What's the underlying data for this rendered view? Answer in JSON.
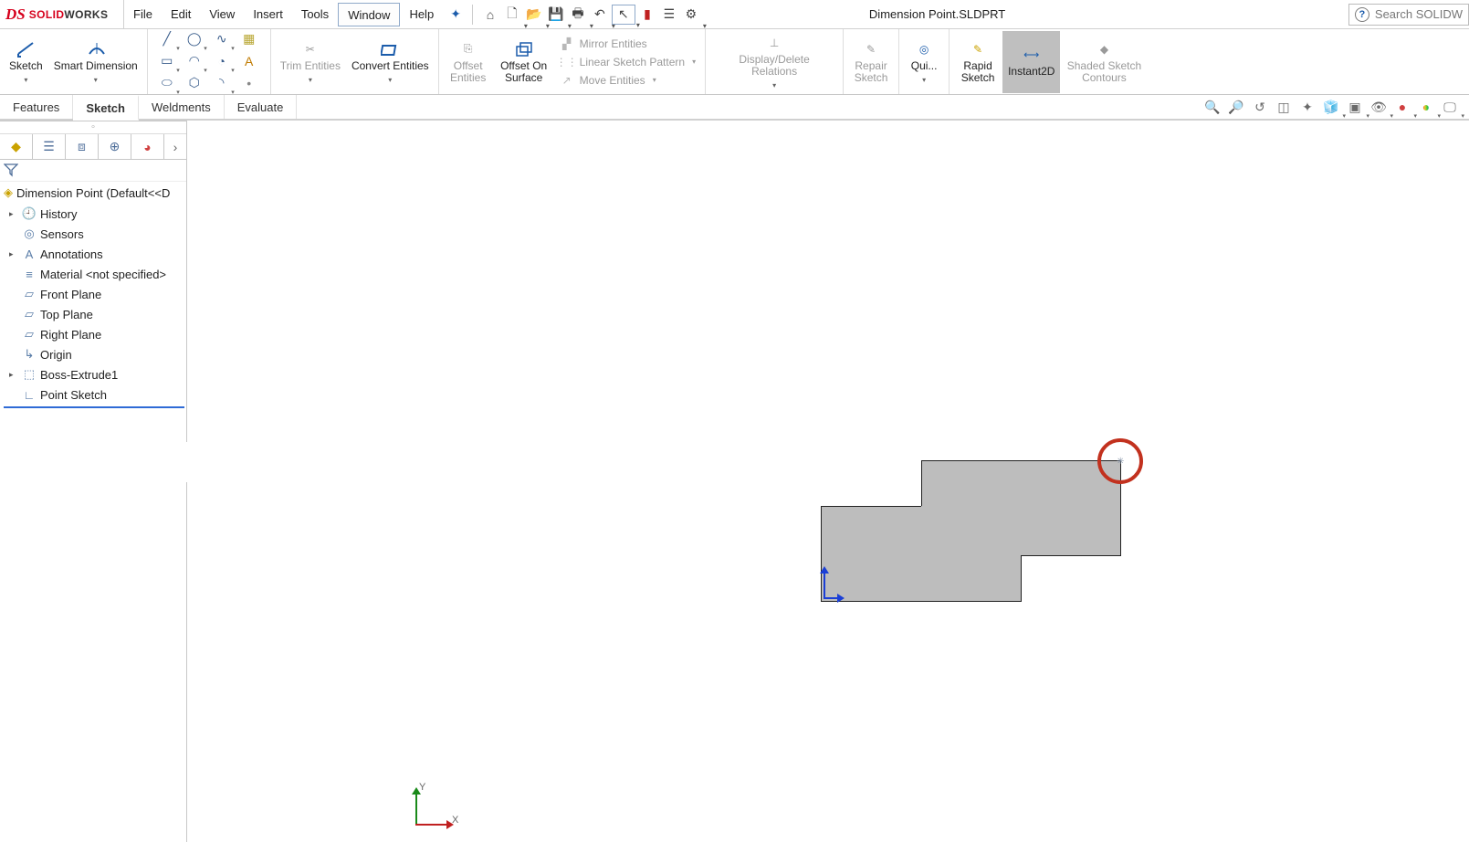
{
  "app": {
    "brand_prefix": "SOLID",
    "brand_suffix": "WORKS",
    "doc_title": "Dimension Point.SLDPRT",
    "search_placeholder": "Search SOLIDW"
  },
  "menubar": [
    "File",
    "Edit",
    "View",
    "Insert",
    "Tools",
    "Window",
    "Help"
  ],
  "ribbon": {
    "sketch_btn": "Sketch",
    "smart_dim": "Smart Dimension",
    "trim": "Trim Entities",
    "convert": "Convert Entities",
    "offset": "Offset Entities",
    "offset_surface": "Offset On Surface",
    "mirror": "Mirror Entities",
    "linear": "Linear Sketch Pattern",
    "move": "Move Entities",
    "display_rel": "Display/Delete Relations",
    "repair": "Repair Sketch",
    "quick": "Qui...",
    "rapid": "Rapid Sketch",
    "instant2d": "Instant2D",
    "shaded": "Shaded Sketch Contours"
  },
  "cmdtabs": [
    "Features",
    "Sketch",
    "Weldments",
    "Evaluate"
  ],
  "tree": {
    "root": "Dimension Point  (Default<<D",
    "nodes": [
      {
        "label": "History",
        "icon": "history"
      },
      {
        "label": "Sensors",
        "icon": "sensor"
      },
      {
        "label": "Annotations",
        "icon": "annot"
      },
      {
        "label": "Material <not specified>",
        "icon": "material"
      },
      {
        "label": "Front Plane",
        "icon": "plane"
      },
      {
        "label": "Top Plane",
        "icon": "plane"
      },
      {
        "label": "Right Plane",
        "icon": "plane"
      },
      {
        "label": "Origin",
        "icon": "origin"
      },
      {
        "label": "Boss-Extrude1",
        "icon": "extrude"
      },
      {
        "label": "Point Sketch",
        "icon": "sketch"
      }
    ]
  },
  "triad": {
    "x": "X",
    "y": "Y"
  }
}
